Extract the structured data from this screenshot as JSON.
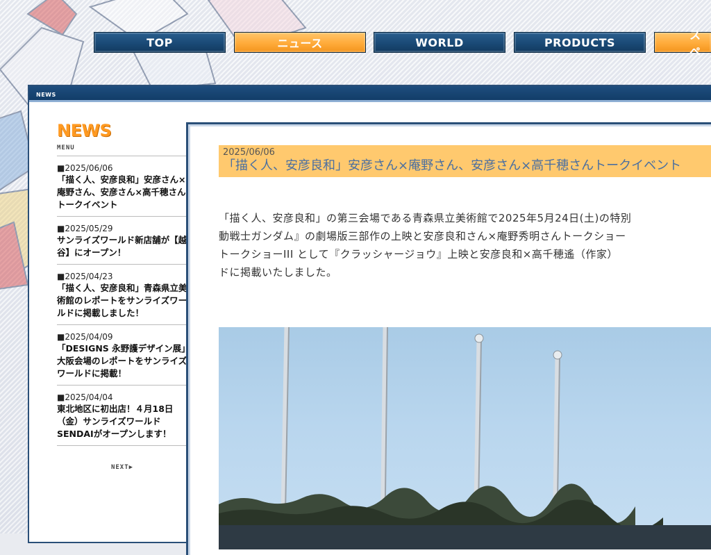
{
  "nav": {
    "items": [
      {
        "label": "TOP",
        "style": "blue"
      },
      {
        "label": "ニュース",
        "style": "orange"
      },
      {
        "label": "WORLD",
        "style": "blue"
      },
      {
        "label": "PRODUCTS",
        "style": "blue"
      },
      {
        "label": "スペ",
        "style": "orange"
      }
    ]
  },
  "window": {
    "title": "NEWS"
  },
  "sidebar": {
    "title": "NEWS",
    "subtitle": "MENU",
    "items": [
      {
        "date": "■2025/06/06",
        "text": "「描く人、安彦良和」安彦さん×庵野さん、安彦さん×高千穂さんトークイベント"
      },
      {
        "date": "■2025/05/29",
        "text": "サンライズワールド新店舗が【越谷】にオープン！"
      },
      {
        "date": "■2025/04/23",
        "text": "「描く人、安彦良和」青森県立美術館のレポートをサンライズワールドに掲載しました！"
      },
      {
        "date": "■2025/04/09",
        "text": "「DESIGNS 永野護デザイン展」大阪会場のレポートをサンライズワールドに掲載！"
      },
      {
        "date": "■2025/04/04",
        "text": "東北地区に初出店！４月18日（金）サンライズワールドSENDAIがオープンします！"
      }
    ],
    "next_label": "NEXT▶"
  },
  "article": {
    "date": "2025/06/06",
    "title": "「描く人、安彦良和」安彦さん×庵野さん、安彦さん×高千穂さんトークイベント",
    "lines": [
      "「描く人、安彦良和」の第三会場である青森県立美術館で2025年5月24日(土)の特別",
      "動戦士ガンダム』の劇場版三部作の上映と安彦良和さん×庵野秀明さんトークショー",
      "トークショーIII として『クラッシャージョウ』上映と安彦良和×高千穂遙（作家）",
      "ドに掲載いたしました。"
    ]
  },
  "colors": {
    "nav_blue": "#1a4a76",
    "nav_orange": "#ffab3a",
    "accent": "#ff9a22",
    "title_blue": "#4a6fa0",
    "head_bg": "#ffc96e"
  }
}
